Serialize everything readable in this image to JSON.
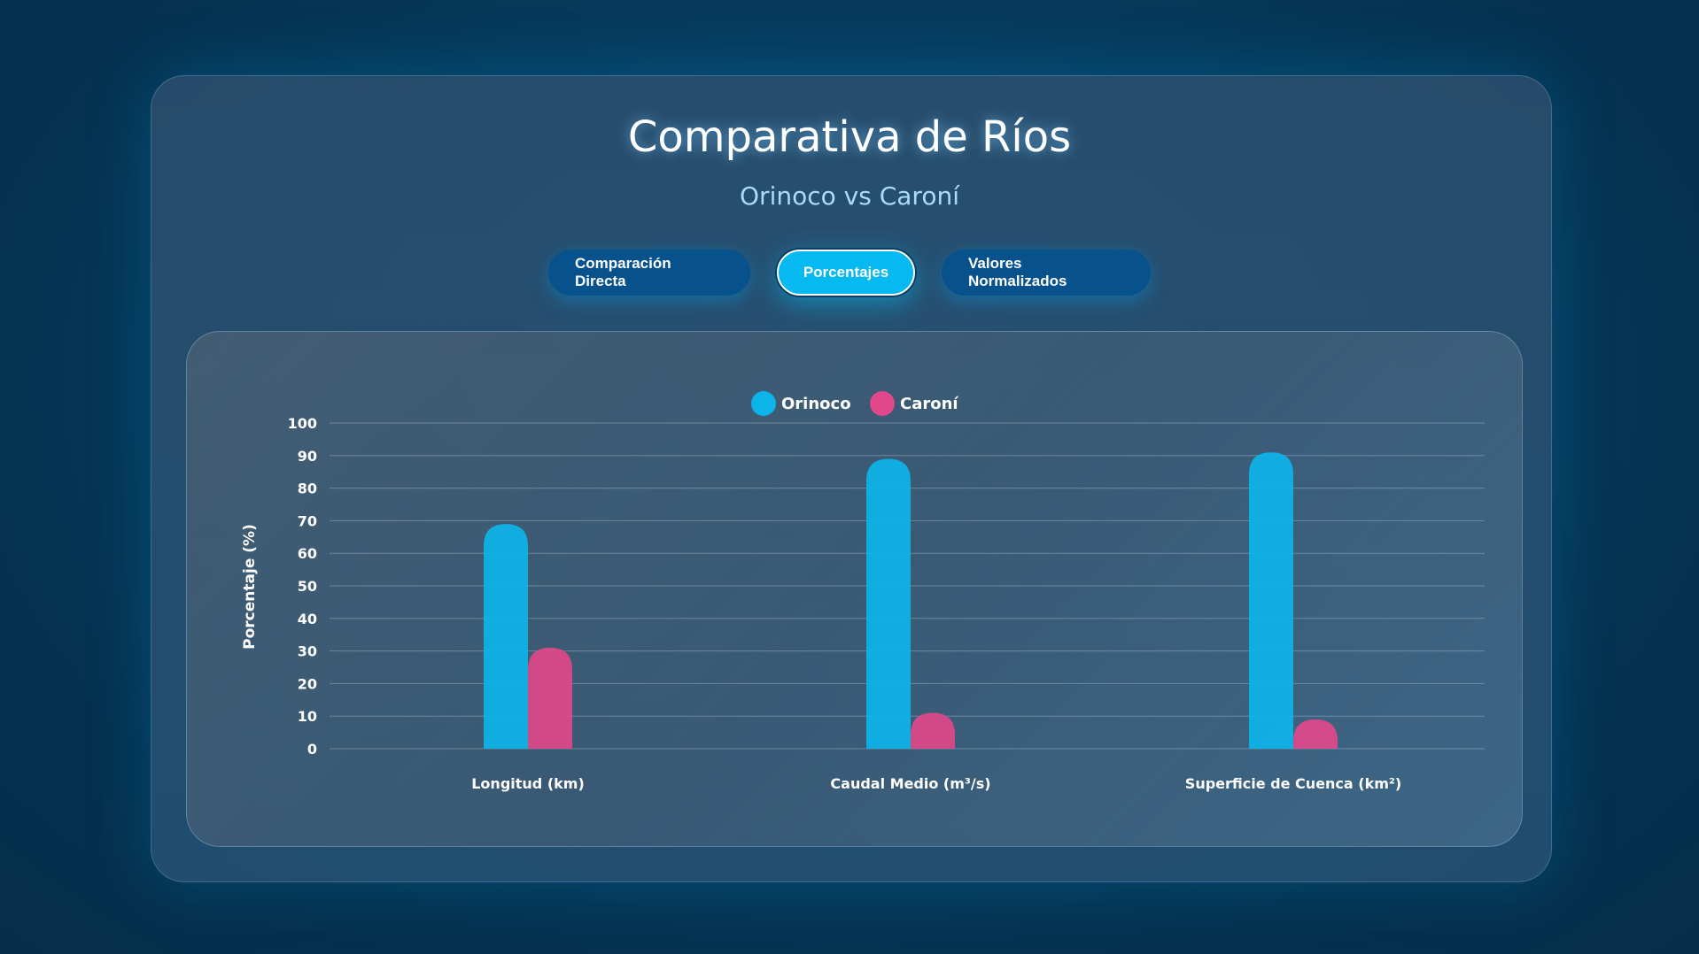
{
  "header": {
    "title": "Comparativa de Ríos",
    "subtitle": "Orinoco vs Caroní"
  },
  "tabs": [
    {
      "label": "Comparación Directa",
      "active": false
    },
    {
      "label": "Porcentajes",
      "active": true
    },
    {
      "label": "Valores Normalizados",
      "active": false
    }
  ],
  "colors": {
    "orinoco": "#0db4ea",
    "caroni": "#e0488a",
    "accent": "#06b9f0"
  },
  "chart_data": {
    "type": "bar",
    "title": "",
    "xlabel": "",
    "ylabel": "Porcentaje (%)",
    "ylim": [
      0,
      100
    ],
    "yticks": [
      0,
      10,
      20,
      30,
      40,
      50,
      60,
      70,
      80,
      90,
      100
    ],
    "grid": true,
    "legend_position": "top-center",
    "categories": [
      "Longitud (km)",
      "Caudal Medio (m³/s)",
      "Superficie de Cuenca (km²)"
    ],
    "series": [
      {
        "name": "Orinoco",
        "values": [
          69,
          89,
          91
        ]
      },
      {
        "name": "Caroní",
        "values": [
          31,
          11,
          9
        ]
      }
    ]
  }
}
